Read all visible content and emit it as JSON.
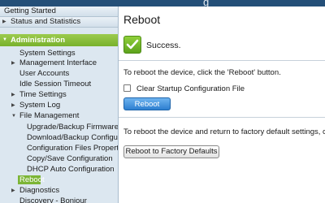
{
  "window": {
    "title_fragment": "g"
  },
  "sidebar": {
    "items": [
      {
        "label": "Getting Started",
        "arrow": ""
      },
      {
        "label": "Status and Statistics",
        "arrow": "▶"
      },
      {
        "label": "Administration",
        "arrow": "▼"
      },
      {
        "label": "System Settings",
        "arrow": ""
      },
      {
        "label": "Management Interface",
        "arrow": "▶"
      },
      {
        "label": "User Accounts",
        "arrow": ""
      },
      {
        "label": "Idle Session Timeout",
        "arrow": ""
      },
      {
        "label": "Time Settings",
        "arrow": "▶"
      },
      {
        "label": "System Log",
        "arrow": "▶"
      },
      {
        "label": "File Management",
        "arrow": "▼"
      },
      {
        "label": "Upgrade/Backup Firmware/L",
        "arrow": ""
      },
      {
        "label": "Download/Backup Configura",
        "arrow": ""
      },
      {
        "label": "Configuration Files Propertie",
        "arrow": ""
      },
      {
        "label": "Copy/Save Configuration",
        "arrow": ""
      },
      {
        "label": "DHCP Auto Configuration",
        "arrow": ""
      },
      {
        "label": "Reboot",
        "arrow": ""
      },
      {
        "label": "Diagnostics",
        "arrow": "▶"
      },
      {
        "label": "Discovery - Bonjour",
        "arrow": ""
      }
    ]
  },
  "main": {
    "title": "Reboot",
    "status_text": "Success.",
    "reboot_instruction": "To reboot the device, click the 'Reboot' button.",
    "clear_config_label": "Clear Startup Configuration File",
    "clear_config_checked": false,
    "reboot_button": "Reboot",
    "factory_instruction": "To reboot the device and return to factory default settings, click th",
    "factory_button": "Reboot to Factory Defaults"
  },
  "colors": {
    "accent_green": "#7cb536",
    "button_blue": "#2d7fd0",
    "header_blue": "#244f78",
    "sidebar_bg": "#dce7f0"
  }
}
